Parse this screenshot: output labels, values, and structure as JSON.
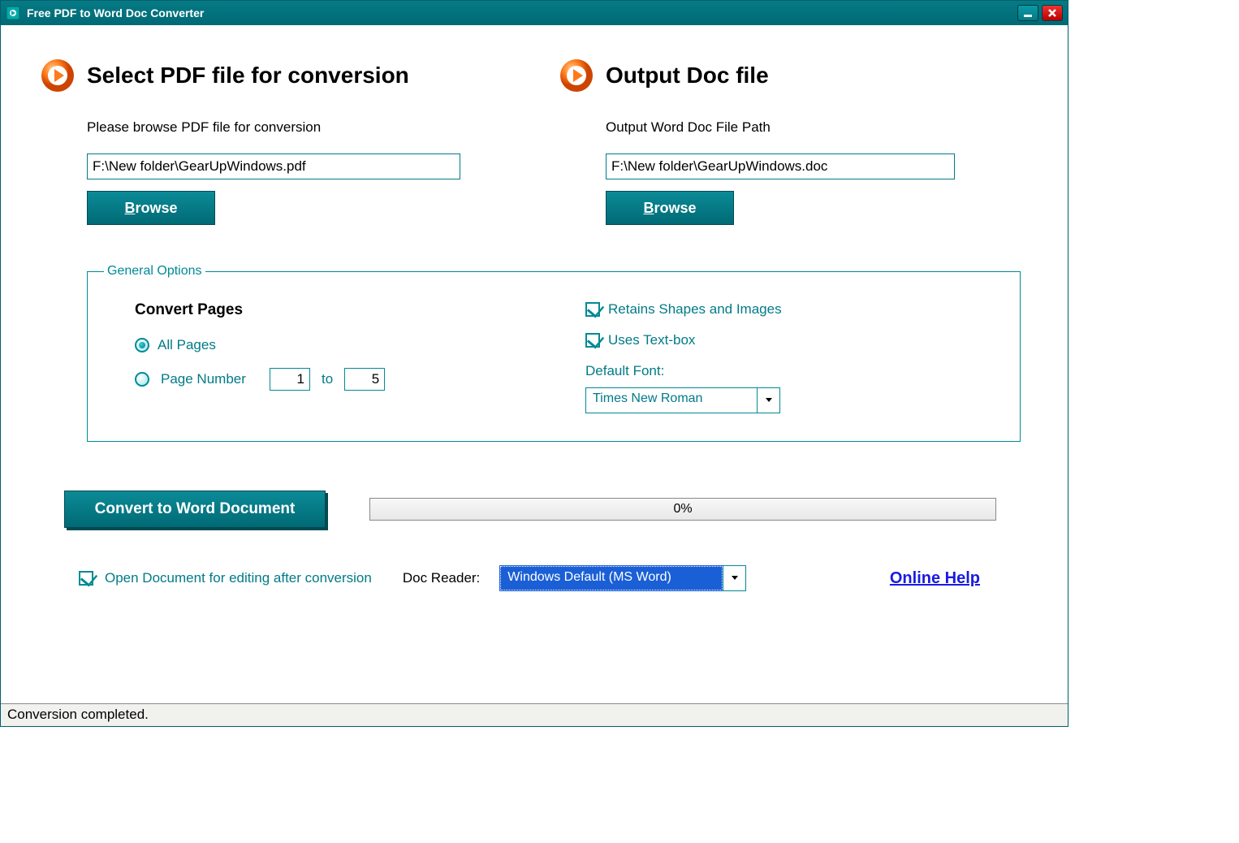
{
  "window": {
    "title": "Free PDF to Word Doc Converter"
  },
  "input_section": {
    "title": "Select PDF file for conversion",
    "hint": "Please browse PDF file for conversion",
    "path": "F:\\New folder\\GearUpWindows.pdf",
    "browse": "Browse"
  },
  "output_section": {
    "title": "Output Doc file",
    "hint": "Output Word Doc File Path",
    "path": "F:\\New folder\\GearUpWindows.doc",
    "browse": "Browse"
  },
  "general": {
    "legend": "General Options",
    "convert_pages_title": "Convert Pages",
    "all_pages": "All Pages",
    "page_number": "Page Number",
    "page_from": "1",
    "to": "to",
    "page_to": "5",
    "retain_shapes": "Retains Shapes and Images",
    "uses_textbox": "Uses Text-box",
    "default_font_label": "Default Font:",
    "default_font_value": "Times New Roman"
  },
  "actions": {
    "convert": "Convert to Word Document",
    "progress": "0%"
  },
  "footer": {
    "open_after": "Open Document for editing after conversion",
    "doc_reader_label": "Doc Reader:",
    "doc_reader_value": "Windows Default (MS Word)",
    "online_help": "Online Help"
  },
  "status": "Conversion completed."
}
